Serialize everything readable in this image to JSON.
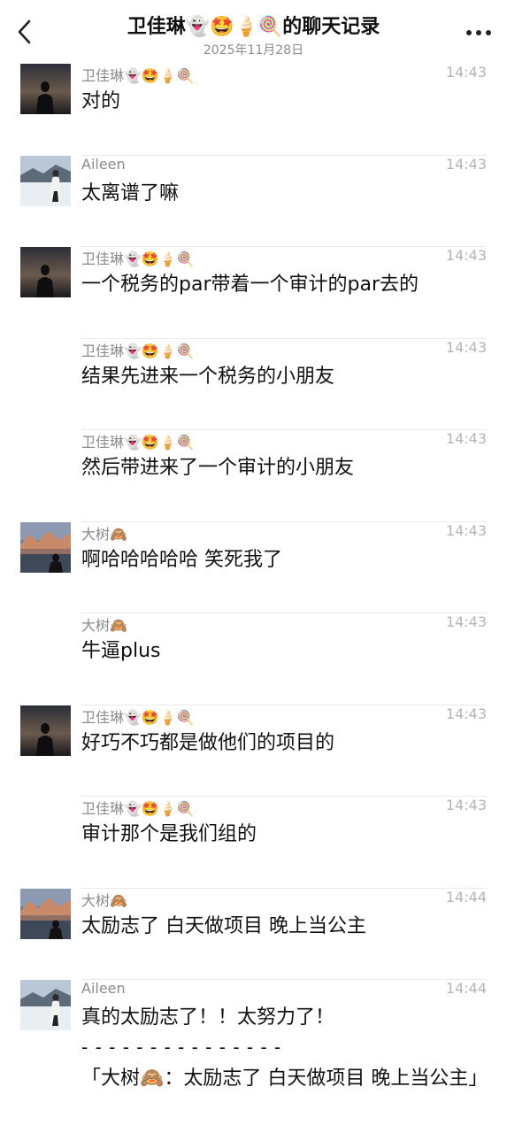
{
  "header": {
    "title": "卫佳琳👻🤩🍦🍭的聊天记录",
    "date": "2025年11月28日",
    "back_icon": "chevron-left-icon",
    "more_icon": "more-horizontal-icon"
  },
  "messages": [
    {
      "sender": "卫佳琳👻🤩🍦🍭",
      "time": "14:43",
      "text": "对的",
      "avatar": "silhouette-sunset"
    },
    {
      "sender": "Aileen",
      "time": "14:43",
      "text": "太离谱了嘛",
      "avatar": "snow-figure"
    },
    {
      "sender": "卫佳琳👻🤩🍦🍭",
      "time": "14:43",
      "text": "一个税务的par带着一个审计的par去的",
      "avatar": "silhouette-sunset"
    },
    {
      "sender": "卫佳琳👻🤩🍦🍭",
      "time": "14:43",
      "text": "结果先进来一个税务的小朋友",
      "avatar": null
    },
    {
      "sender": "卫佳琳👻🤩🍦🍭",
      "time": "14:43",
      "text": "然后带进来了一个审计的小朋友",
      "avatar": null
    },
    {
      "sender": "大树🙈",
      "time": "14:43",
      "text": "啊哈哈哈哈哈 笑死我了",
      "avatar": "mountain-lake"
    },
    {
      "sender": "大树🙈",
      "time": "14:43",
      "text": "牛逼plus",
      "avatar": null
    },
    {
      "sender": "卫佳琳👻🤩🍦🍭",
      "time": "14:43",
      "text": "好巧不巧都是做他们的项目的",
      "avatar": "silhouette-sunset"
    },
    {
      "sender": "卫佳琳👻🤩🍦🍭",
      "time": "14:43",
      "text": "审计那个是我们组的",
      "avatar": null
    },
    {
      "sender": "大树🙈",
      "time": "14:44",
      "text": "太励志了 白天做项目 晚上当公主",
      "avatar": "mountain-lake"
    },
    {
      "sender": "Aileen",
      "time": "14:44",
      "text": "真的太励志了！！太努力了！",
      "avatar": "snow-figure",
      "separator": "- - - - - - - - - - - - - - -",
      "quote": "「大树🙈：太励志了 白天做项目 晚上当公主」"
    }
  ]
}
